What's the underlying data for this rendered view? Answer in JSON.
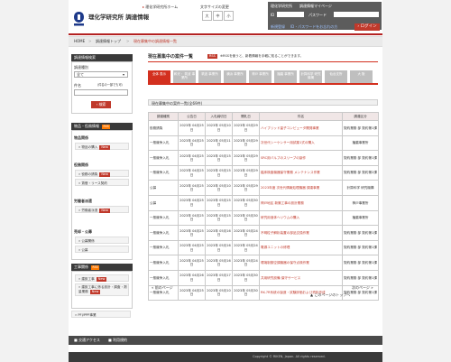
{
  "header": {
    "site_title": "理化学研究所 調達情報",
    "home_link": "理化学研究所ホーム",
    "text_size_label": "文字サイズの変更",
    "size_large": "大",
    "size_medium": "中",
    "size_small": "小"
  },
  "login": {
    "nav_riken": "理化学研究所",
    "nav_mypage": "調達情報マイページ",
    "id_label": "ID",
    "password_label": "パスワード",
    "register": "新規登録",
    "forgot": "ID・パスワードをお忘れの方",
    "login_button": "ログイン"
  },
  "breadcrumb": {
    "home": "HOME",
    "top": "調達情報トップ",
    "current": "現在募集中の調達情報一覧",
    "sep": ">"
  },
  "sidebar": {
    "search_title": "調達情報検索",
    "category_label": "調達種別",
    "category_value": "全て",
    "keyword_label": "件名",
    "keyword_hint": "（件名の一部でも可）",
    "search_button": "検索",
    "goods_title": "物品・役務情報",
    "goods_rss": "RSS",
    "goods_section": "物品関係",
    "goods_items": [
      {
        "label": "物品の購入",
        "new": "New"
      }
    ],
    "service_section": "役務関係",
    "service_items": [
      {
        "label": "役務の請負",
        "new": "New"
      },
      {
        "label": "賃借・リース契約",
        "new": ""
      }
    ],
    "dispatch_section": "労働者派遣",
    "dispatch_items": [
      {
        "label": "労働者派遣",
        "new": "New"
      }
    ],
    "sale_section": "売却・公募",
    "sale_items": [
      {
        "label": "公募関係",
        "new": ""
      },
      {
        "label": "公募",
        "new": ""
      }
    ],
    "construction_title": "工事関係",
    "construction_rss": "RSS",
    "construction_items": [
      {
        "label": "建設工事",
        "new": "New"
      },
      {
        "label": "建設工事に係る設計・調査・測量業務",
        "new": "New"
      }
    ],
    "pfi": "PFI/PPP事業"
  },
  "main": {
    "heading": "現在募集中の案件一覧",
    "rss": "RSS",
    "rss_note": "※RSSを使うと、新着情報を手軽に知ることができます。",
    "tabs": [
      {
        "label": "全体 表示",
        "active": true
      },
      {
        "label": "和光・ 筑波 事業所",
        "active": false
      },
      {
        "label": "筑波 事業所",
        "active": false
      },
      {
        "label": "横浜 事業所",
        "active": false
      },
      {
        "label": "神戸 事業所",
        "active": false
      },
      {
        "label": "播磨 事業所",
        "active": false
      },
      {
        "label": "計算科学 研究機構",
        "active": false
      },
      {
        "label": "仙台支所",
        "active": false
      },
      {
        "label": "大 阪",
        "active": false
      }
    ],
    "list_title": "現在募集中の案件一覧(全69件)",
    "columns": [
      "調達種別",
      "公告日",
      "入札締切日",
      "開札日",
      "件名",
      "調達区分"
    ],
    "rows": [
      [
        "役務請負",
        "2023年 04月25日",
        "2023年 05月10日",
        "2023年 05月29日",
        "ハイブリッド量子コンピュータ開発事業",
        "契約業務 部 契約第1課"
      ],
      [
        "一般競争入札",
        "2023年 04月25日",
        "2023年 05月11日",
        "2023年 05月29日",
        "次世代シーケンサー用試薬1式の購入",
        "播磨事業所"
      ],
      [
        "一般競争入札",
        "2023年 04月25日",
        "2023年 05月15日",
        "2023年 05月29日",
        "SRC用バルブのスリーブの製作",
        "契約業務 部 契約第1課"
      ],
      [
        "一般競争入札",
        "2023年 04月25日",
        "2023年 05月15日",
        "2023年 05月29日",
        "臨床検査機器保守業務 メンテナンス作業",
        "契約業務 部 契約第2課"
      ],
      [
        "公募",
        "2023年 04月25日",
        "2023年 05月10日",
        "2023年 05月29日",
        "2023年度 次世代情報処理機器 調達事業",
        "計算科学 研究機構"
      ],
      [
        "公募",
        "2023年 04月25日",
        "2023年 05月15日",
        "2023年 05月30日",
        "神戸地区 新築工事の設計業務",
        "神戸事業所"
      ],
      [
        "一般競争入札",
        "2023年 04月25日",
        "2023年 05月15日",
        "2023年 05月30日",
        "研究用液体ヘリウムの購入",
        "播磨事業所"
      ],
      [
        "一般競争入札",
        "2023年 04月25日",
        "2023年 05月16日",
        "2023年 05月24日",
        "不明粒子解析装置の部品交換作業",
        "契約業務 部 契約第1課"
      ],
      [
        "一般競争入札",
        "2023年 04月25日",
        "2023年 05月16日",
        "2023年 05月24日",
        "電源ユニットの修理",
        "契約業務 部 契約第1課"
      ],
      [
        "一般競争入札",
        "2023年 04月25日",
        "2023年 05月16日",
        "2023年 05月24日",
        "環境制御空調機器の保守点検作業",
        "契約業務 部 契約第1課"
      ],
      [
        "一般競争入札",
        "2023年 04月26日",
        "2023年 05月17日",
        "2023年 05月30日",
        "共用研究設備 保守サービス",
        "契約業務 部 契約第1課"
      ],
      [
        "一般競争入札",
        "2023年 04月25日",
        "2023年 05月10日",
        "2023年 05月30日",
        "RK-7R系統の製造・試験評価および資料作成",
        "契約業務 部 契約第1課"
      ]
    ],
    "prev_page": "前のページ",
    "next_page": "次のページ",
    "page_bottom": "このページのトップへ"
  },
  "footer": {
    "access": "交通アクセス",
    "terms": "利用規約",
    "copyright": "Copyright © RIKEN, Japan. All rights reserved."
  },
  "colors": {
    "brand_red": "#d3301f",
    "tab_inactive": "#bfbfbf",
    "header_dark": "#3a3a3a"
  }
}
